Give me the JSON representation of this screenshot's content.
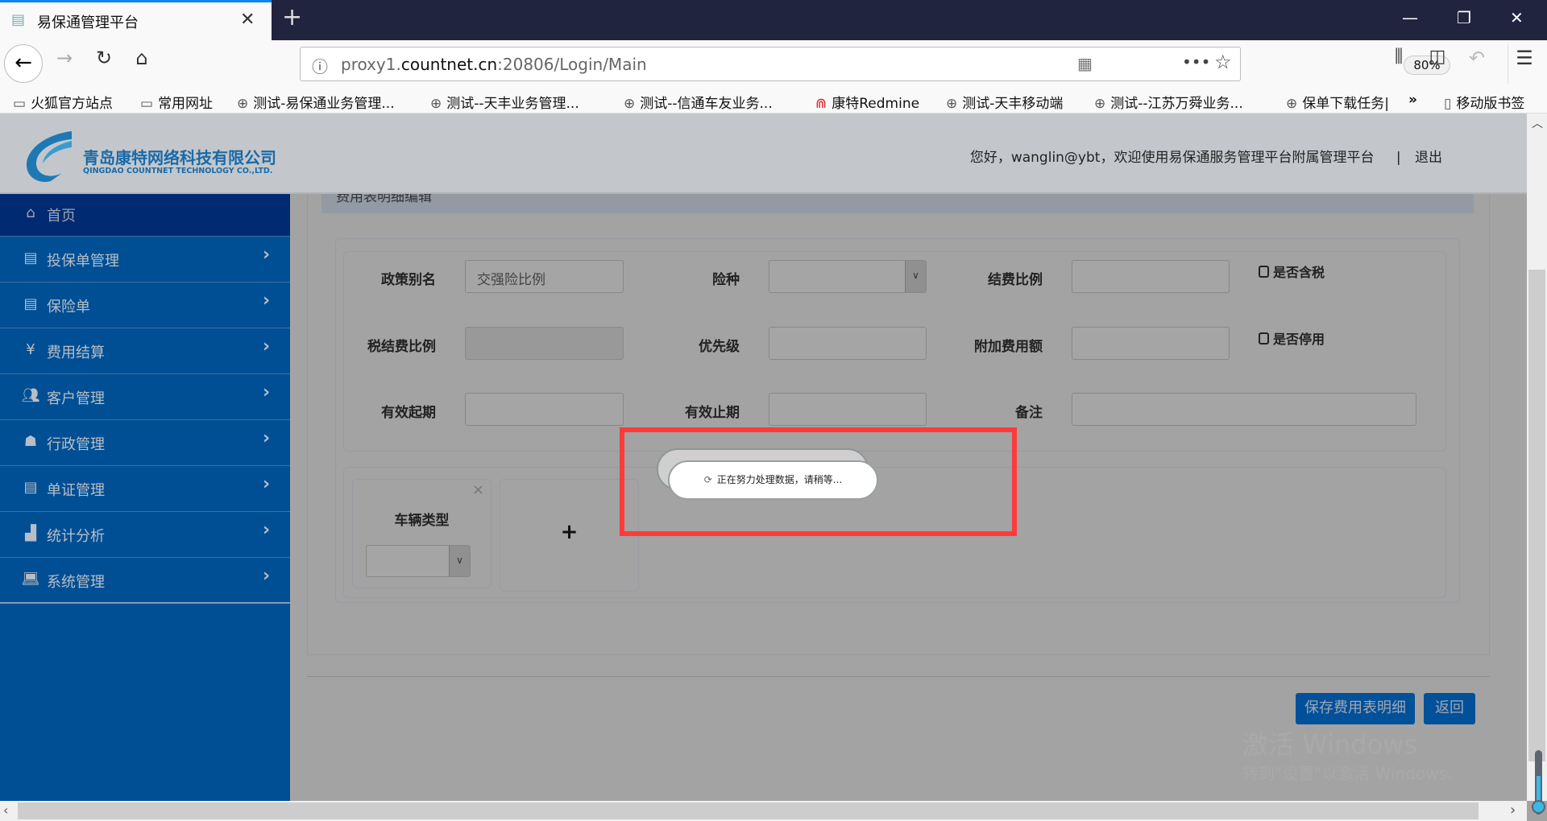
{
  "browser": {
    "tab_title": "易保通管理平台",
    "url_prefix": "proxy1.",
    "url_domain": "countnet.cn",
    "url_suffix": ":20806/Login/Main",
    "zoom": "80%",
    "bookmarks": [
      "火狐官方站点",
      "常用网址",
      "测试-易保通业务管理...",
      "测试--天丰业务管理...",
      "测试--信通车友业务...",
      "康特Redmine",
      "测试-天丰移动端",
      "测试--江苏万舜业务...",
      "保单下载任务|",
      "移动版书签"
    ]
  },
  "header": {
    "company_cn": "青岛康特网络科技有限公司",
    "company_en": "QINGDAO COUNTNET TECHNOLOGY CO.,LTD.",
    "greeting": "您好，wanglin@ybt，欢迎使用易保通服务管理平台附属管理平台",
    "logout": "退出"
  },
  "sidebar": {
    "items": [
      {
        "label": "首页",
        "icon": "home-icon"
      },
      {
        "label": "投保单管理",
        "icon": "document-icon"
      },
      {
        "label": "保险单",
        "icon": "list-icon"
      },
      {
        "label": "费用结算",
        "icon": "money-bag-icon"
      },
      {
        "label": "客户管理",
        "icon": "users-icon"
      },
      {
        "label": "行政管理",
        "icon": "group-icon"
      },
      {
        "label": "单证管理",
        "icon": "list-icon"
      },
      {
        "label": "统计分析",
        "icon": "chart-icon"
      },
      {
        "label": "系统管理",
        "icon": "laptop-icon"
      }
    ]
  },
  "form": {
    "panel_title": "费用表明细编辑",
    "policy_alias_label": "政策别名",
    "policy_alias_value": "交强险比例",
    "insurance_type_label": "险种",
    "insurance_type_value": "",
    "settle_ratio_label": "结费比例",
    "tax_included_label": "是否含税",
    "tax_settle_ratio_label": "税结费比例",
    "priority_label": "优先级",
    "extra_fee_label": "附加费用额",
    "disabled_label": "是否停用",
    "start_label": "有效起期",
    "end_label": "有效止期",
    "remark_label": "备注",
    "vehicle_type_label": "车辆类型",
    "add_symbol": "+",
    "remove_symbol": "×"
  },
  "loading": {
    "message": "正在努力处理数据，请稍等..."
  },
  "actions": {
    "save": "保存费用表明细",
    "back": "返回"
  },
  "watermark": {
    "line1": "激活 Windows",
    "line2": "转到\"设置\"以激活 Windows。"
  }
}
